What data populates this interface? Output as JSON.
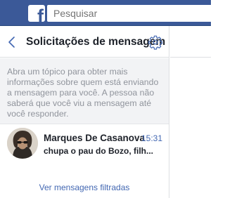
{
  "topbar": {
    "logo": "f",
    "search_placeholder": "Pesquisar",
    "brand_color": "#3b5998"
  },
  "panel": {
    "title": "Solicitações de mensagem",
    "back_icon": "chevron-left-icon",
    "settings_icon": "gear-icon",
    "info_text": "Abra um tópico para obter mais informações sobre quem está enviando a mensagem para você. A pessoa não saberá que você viu a mensagem até você responder.",
    "threads": [
      {
        "sender": "Marques De Casanova",
        "time": "15:31",
        "snippet": "chupa o pau do Bozo, filh..."
      }
    ],
    "filtered_link": "Ver mensagens filtradas",
    "accent_color": "#4267b2"
  }
}
